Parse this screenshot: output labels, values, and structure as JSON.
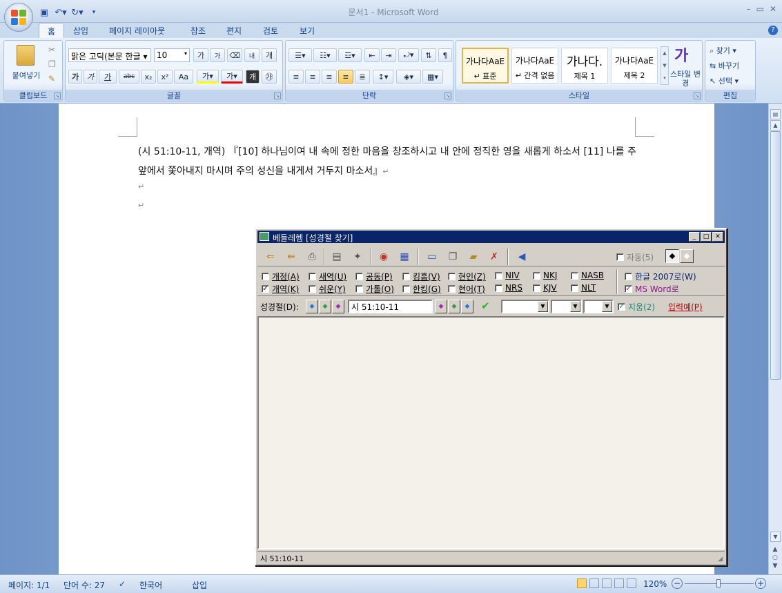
{
  "window": {
    "title": "문서1 - Microsoft Word",
    "minimize": "–",
    "restore": "▭",
    "close": "✕"
  },
  "qat": [
    "save-icon",
    "undo-icon",
    "redo-icon",
    "customize-icon"
  ],
  "tabs": [
    "홈",
    "삽입",
    "페이지 레이아웃",
    "참조",
    "편지",
    "검토",
    "보기"
  ],
  "ribbon": {
    "clipboard": {
      "label": "클립보드",
      "paste": "붙여넣기"
    },
    "font": {
      "label": "글꼴",
      "font_name": "맑은 고딕(본문 한글",
      "font_size": "10",
      "bold": "가",
      "italic": "가",
      "underline": "가",
      "strike": "abc",
      "sub": "x₂",
      "sup": "x²",
      "case": "Aa"
    },
    "paragraph": {
      "label": "단락"
    },
    "styles": {
      "label": "스타일",
      "items": [
        {
          "sample": "가나다AaE",
          "name": "↵ 표준"
        },
        {
          "sample": "가나다AaE",
          "name": "↵ 간격 없음"
        },
        {
          "sample": "가나다.",
          "name": "제목 1"
        },
        {
          "sample": "가나다AaE",
          "name": "제목 2"
        }
      ],
      "change": "스타일 변경"
    },
    "editing": {
      "label": "편집",
      "find": "찾기",
      "replace": "바꾸기",
      "select": "선택"
    }
  },
  "document": {
    "text": "(시 51:10-11, 개역) 『[10] 하나님이여 내 속에 정한 마음을 창조하시고 내 안에 정직한 영을 새롭게 하소서 [11] 나를 주 앞에서 쫓아내지 마시며 주의 성신을 내게서 거두지 마소서』",
    "para_mark": "↵"
  },
  "status": {
    "page": "페이지: 1/1",
    "words": "단어 수: 27",
    "lang": "한국어",
    "mode": "삽입",
    "zoom": "120%"
  },
  "dialog": {
    "title": "베들레헴 [성경절 찾기]",
    "auto": "자동(5)",
    "versions_row1": [
      {
        "label": "개정(A)",
        "checked": false
      },
      {
        "label": "새역(U)",
        "checked": false
      },
      {
        "label": "공동(P)",
        "checked": false
      },
      {
        "label": "킹흠(V)",
        "checked": false
      },
      {
        "label": "현인(Z)",
        "checked": false
      },
      {
        "label": "NIV",
        "checked": false
      },
      {
        "label": "NKJ",
        "checked": false
      },
      {
        "label": "NASB",
        "checked": false
      }
    ],
    "versions_row2": [
      {
        "label": "개역(K)",
        "checked": true
      },
      {
        "label": "쉬운(Y)",
        "checked": false
      },
      {
        "label": "가톨(O)",
        "checked": false
      },
      {
        "label": "한킹(G)",
        "checked": false
      },
      {
        "label": "현어(T)",
        "checked": false
      },
      {
        "label": "NRS",
        "checked": false
      },
      {
        "label": "KJV",
        "checked": false
      },
      {
        "label": "NLT",
        "checked": false
      }
    ],
    "hangul2007": "한글 2007로(W)",
    "msword": "MS Word로",
    "verse_label": "성경절(D):",
    "verse_value": "시 51:10-11",
    "erase": "지움(2)",
    "example": "입력예(P)",
    "status_text": "시 51:10-11"
  }
}
